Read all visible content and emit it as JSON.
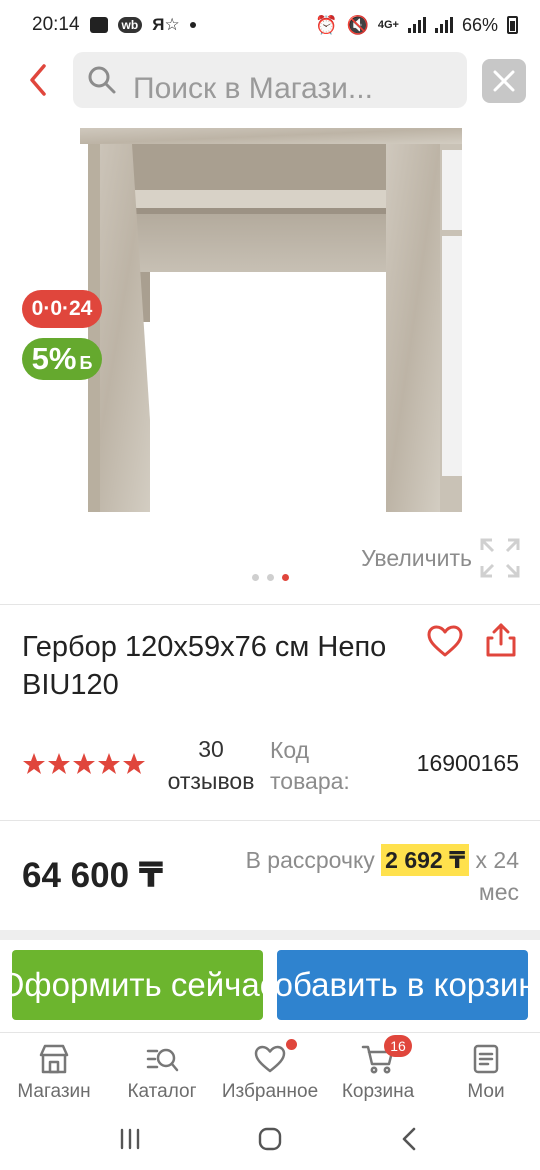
{
  "status_bar": {
    "time": "20:14",
    "carrier_badge": "wb",
    "network": "4G+",
    "battery": "66%"
  },
  "search": {
    "placeholder": "Поиск в Магази..."
  },
  "gallery": {
    "timer_badge": "0·0·24",
    "bonus_value": "5%",
    "bonus_suffix": "Б",
    "zoom_label": "Увеличить",
    "dots_count": 3,
    "active_dot": 3
  },
  "product": {
    "title": "Гербор 120х59х76 см Непо BIU120",
    "rating": 5,
    "reviews_count": "30",
    "reviews_label": "отзывов",
    "code_label": "Код товара:",
    "code_value": "16900165",
    "price": "64 600 ₸",
    "installment_label": "В рассрочку",
    "installment_amount": "2 692 ₸",
    "installment_term": "х 24 мес"
  },
  "actions": {
    "checkout_label": "Оформить сейчас",
    "add_to_cart_label": "Добавить в корзину"
  },
  "bottom_nav": {
    "items": [
      {
        "label": "Магазин",
        "icon": "store-icon"
      },
      {
        "label": "Каталог",
        "icon": "catalog-search-icon"
      },
      {
        "label": "Избранное",
        "icon": "heart-icon"
      },
      {
        "label": "Корзина",
        "icon": "cart-icon",
        "badge": "16"
      },
      {
        "label": "Мои",
        "icon": "orders-icon"
      }
    ]
  },
  "colors": {
    "accent_red": "#e0463c",
    "checkout_green": "#6cb52e",
    "cart_blue": "#2f83cf",
    "installment_yellow": "#ffe14d"
  }
}
